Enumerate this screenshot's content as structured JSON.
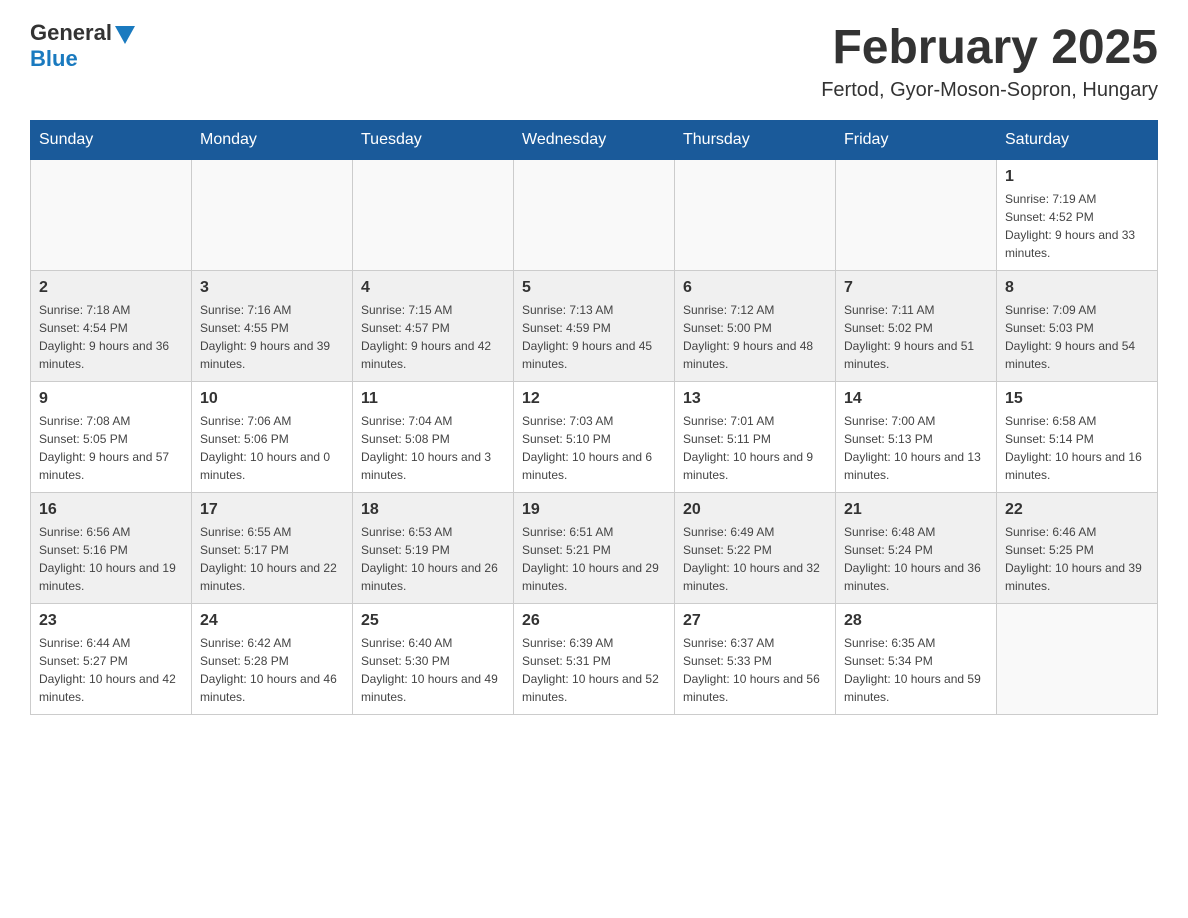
{
  "header": {
    "logo_general": "General",
    "logo_blue": "Blue",
    "month_title": "February 2025",
    "location": "Fertod, Gyor-Moson-Sopron, Hungary"
  },
  "weekdays": [
    "Sunday",
    "Monday",
    "Tuesday",
    "Wednesday",
    "Thursday",
    "Friday",
    "Saturday"
  ],
  "weeks": [
    [
      {
        "day": "",
        "sunrise": "",
        "sunset": "",
        "daylight": ""
      },
      {
        "day": "",
        "sunrise": "",
        "sunset": "",
        "daylight": ""
      },
      {
        "day": "",
        "sunrise": "",
        "sunset": "",
        "daylight": ""
      },
      {
        "day": "",
        "sunrise": "",
        "sunset": "",
        "daylight": ""
      },
      {
        "day": "",
        "sunrise": "",
        "sunset": "",
        "daylight": ""
      },
      {
        "day": "",
        "sunrise": "",
        "sunset": "",
        "daylight": ""
      },
      {
        "day": "1",
        "sunrise": "Sunrise: 7:19 AM",
        "sunset": "Sunset: 4:52 PM",
        "daylight": "Daylight: 9 hours and 33 minutes."
      }
    ],
    [
      {
        "day": "2",
        "sunrise": "Sunrise: 7:18 AM",
        "sunset": "Sunset: 4:54 PM",
        "daylight": "Daylight: 9 hours and 36 minutes."
      },
      {
        "day": "3",
        "sunrise": "Sunrise: 7:16 AM",
        "sunset": "Sunset: 4:55 PM",
        "daylight": "Daylight: 9 hours and 39 minutes."
      },
      {
        "day": "4",
        "sunrise": "Sunrise: 7:15 AM",
        "sunset": "Sunset: 4:57 PM",
        "daylight": "Daylight: 9 hours and 42 minutes."
      },
      {
        "day": "5",
        "sunrise": "Sunrise: 7:13 AM",
        "sunset": "Sunset: 4:59 PM",
        "daylight": "Daylight: 9 hours and 45 minutes."
      },
      {
        "day": "6",
        "sunrise": "Sunrise: 7:12 AM",
        "sunset": "Sunset: 5:00 PM",
        "daylight": "Daylight: 9 hours and 48 minutes."
      },
      {
        "day": "7",
        "sunrise": "Sunrise: 7:11 AM",
        "sunset": "Sunset: 5:02 PM",
        "daylight": "Daylight: 9 hours and 51 minutes."
      },
      {
        "day": "8",
        "sunrise": "Sunrise: 7:09 AM",
        "sunset": "Sunset: 5:03 PM",
        "daylight": "Daylight: 9 hours and 54 minutes."
      }
    ],
    [
      {
        "day": "9",
        "sunrise": "Sunrise: 7:08 AM",
        "sunset": "Sunset: 5:05 PM",
        "daylight": "Daylight: 9 hours and 57 minutes."
      },
      {
        "day": "10",
        "sunrise": "Sunrise: 7:06 AM",
        "sunset": "Sunset: 5:06 PM",
        "daylight": "Daylight: 10 hours and 0 minutes."
      },
      {
        "day": "11",
        "sunrise": "Sunrise: 7:04 AM",
        "sunset": "Sunset: 5:08 PM",
        "daylight": "Daylight: 10 hours and 3 minutes."
      },
      {
        "day": "12",
        "sunrise": "Sunrise: 7:03 AM",
        "sunset": "Sunset: 5:10 PM",
        "daylight": "Daylight: 10 hours and 6 minutes."
      },
      {
        "day": "13",
        "sunrise": "Sunrise: 7:01 AM",
        "sunset": "Sunset: 5:11 PM",
        "daylight": "Daylight: 10 hours and 9 minutes."
      },
      {
        "day": "14",
        "sunrise": "Sunrise: 7:00 AM",
        "sunset": "Sunset: 5:13 PM",
        "daylight": "Daylight: 10 hours and 13 minutes."
      },
      {
        "day": "15",
        "sunrise": "Sunrise: 6:58 AM",
        "sunset": "Sunset: 5:14 PM",
        "daylight": "Daylight: 10 hours and 16 minutes."
      }
    ],
    [
      {
        "day": "16",
        "sunrise": "Sunrise: 6:56 AM",
        "sunset": "Sunset: 5:16 PM",
        "daylight": "Daylight: 10 hours and 19 minutes."
      },
      {
        "day": "17",
        "sunrise": "Sunrise: 6:55 AM",
        "sunset": "Sunset: 5:17 PM",
        "daylight": "Daylight: 10 hours and 22 minutes."
      },
      {
        "day": "18",
        "sunrise": "Sunrise: 6:53 AM",
        "sunset": "Sunset: 5:19 PM",
        "daylight": "Daylight: 10 hours and 26 minutes."
      },
      {
        "day": "19",
        "sunrise": "Sunrise: 6:51 AM",
        "sunset": "Sunset: 5:21 PM",
        "daylight": "Daylight: 10 hours and 29 minutes."
      },
      {
        "day": "20",
        "sunrise": "Sunrise: 6:49 AM",
        "sunset": "Sunset: 5:22 PM",
        "daylight": "Daylight: 10 hours and 32 minutes."
      },
      {
        "day": "21",
        "sunrise": "Sunrise: 6:48 AM",
        "sunset": "Sunset: 5:24 PM",
        "daylight": "Daylight: 10 hours and 36 minutes."
      },
      {
        "day": "22",
        "sunrise": "Sunrise: 6:46 AM",
        "sunset": "Sunset: 5:25 PM",
        "daylight": "Daylight: 10 hours and 39 minutes."
      }
    ],
    [
      {
        "day": "23",
        "sunrise": "Sunrise: 6:44 AM",
        "sunset": "Sunset: 5:27 PM",
        "daylight": "Daylight: 10 hours and 42 minutes."
      },
      {
        "day": "24",
        "sunrise": "Sunrise: 6:42 AM",
        "sunset": "Sunset: 5:28 PM",
        "daylight": "Daylight: 10 hours and 46 minutes."
      },
      {
        "day": "25",
        "sunrise": "Sunrise: 6:40 AM",
        "sunset": "Sunset: 5:30 PM",
        "daylight": "Daylight: 10 hours and 49 minutes."
      },
      {
        "day": "26",
        "sunrise": "Sunrise: 6:39 AM",
        "sunset": "Sunset: 5:31 PM",
        "daylight": "Daylight: 10 hours and 52 minutes."
      },
      {
        "day": "27",
        "sunrise": "Sunrise: 6:37 AM",
        "sunset": "Sunset: 5:33 PM",
        "daylight": "Daylight: 10 hours and 56 minutes."
      },
      {
        "day": "28",
        "sunrise": "Sunrise: 6:35 AM",
        "sunset": "Sunset: 5:34 PM",
        "daylight": "Daylight: 10 hours and 59 minutes."
      },
      {
        "day": "",
        "sunrise": "",
        "sunset": "",
        "daylight": ""
      }
    ]
  ]
}
